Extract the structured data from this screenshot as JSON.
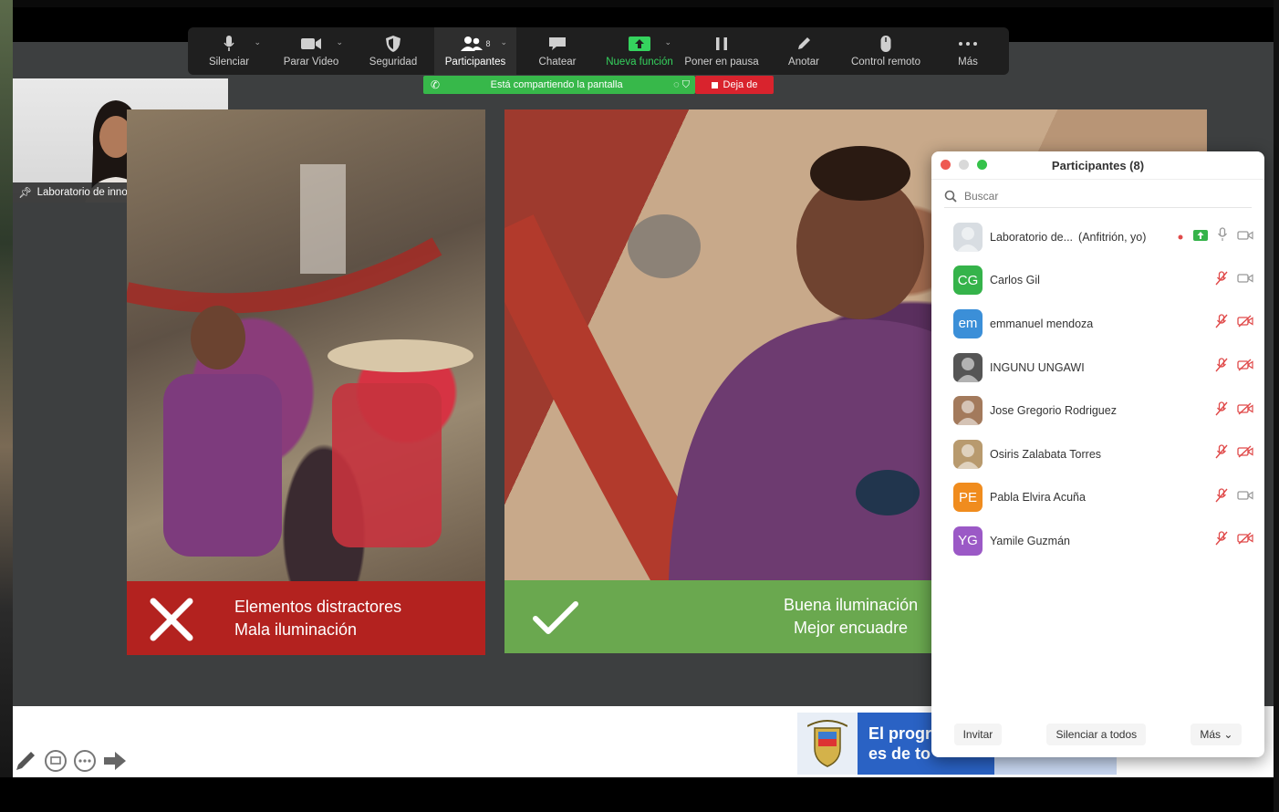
{
  "toolbar": {
    "items": [
      {
        "label": "Silenciar",
        "icon": "microphone-icon"
      },
      {
        "label": "Parar Video",
        "icon": "video-camera-icon"
      },
      {
        "label": "Seguridad",
        "icon": "shield-icon"
      },
      {
        "label": "Participantes",
        "icon": "participants-icon",
        "count": "8"
      },
      {
        "label": "Chatear",
        "icon": "chat-bubble-icon"
      },
      {
        "label": "Nueva función",
        "icon": "share-screen-icon"
      },
      {
        "label": "Poner en pausa",
        "icon": "pause-icon"
      },
      {
        "label": "Anotar",
        "icon": "pencil-icon"
      },
      {
        "label": "Control remoto",
        "icon": "mouse-icon"
      },
      {
        "label": "Más",
        "icon": "more-dots-icon"
      }
    ]
  },
  "share_banner": {
    "label": "Está compartiendo la pantalla",
    "stop_label": "Deja de"
  },
  "self_view": {
    "name": "Laboratorio de innovación..."
  },
  "slide": {
    "left_caption": [
      "Elementos distractores",
      "Mala iluminación"
    ],
    "right_caption": [
      "Buena iluminación",
      "Mejor encuadre"
    ]
  },
  "banner": {
    "line1": "El progr",
    "line2": "es de to"
  },
  "participants": {
    "title": "Participantes (8)",
    "search_placeholder": "Buscar",
    "items": [
      {
        "name": "Laboratorio de...",
        "suffix": "(Anfitrión, yo)",
        "initials": "",
        "color": "#d8dde2",
        "muted": false,
        "video_off": false
      },
      {
        "name": "Carlos Gil",
        "initials": "CG",
        "color": "#35b34a",
        "muted": true,
        "video_off": false
      },
      {
        "name": "emmanuel mendoza",
        "initials": "em",
        "color": "#3b8fd8",
        "muted": true,
        "video_off": true
      },
      {
        "name": "INGUNU UNGAWI",
        "initials": "",
        "color": "#555555",
        "muted": true,
        "video_off": true
      },
      {
        "name": "Jose Gregorio Rodriguez",
        "initials": "",
        "color": "#a37a5c",
        "muted": true,
        "video_off": true
      },
      {
        "name": "Osiris Zalabata Torres",
        "initials": "",
        "color": "#b89a6e",
        "muted": true,
        "video_off": true
      },
      {
        "name": "Pabla Elvira Acuña",
        "initials": "PE",
        "color": "#f08c1e",
        "muted": true,
        "video_off": false
      },
      {
        "name": "Yamile Guzmán",
        "initials": "YG",
        "color": "#9b59c6",
        "muted": true,
        "video_off": true
      }
    ],
    "footer": {
      "invite": "Invitar",
      "mute_all": "Silenciar a todos",
      "more": "Más"
    }
  },
  "colors": {
    "toolbar_bg": "#1f1f1f",
    "share_green": "#37b84a",
    "stop_red": "#d9232d",
    "bad_red": "#b3221f",
    "good_green": "#6aa84f",
    "mute_red": "#e04a4a"
  }
}
